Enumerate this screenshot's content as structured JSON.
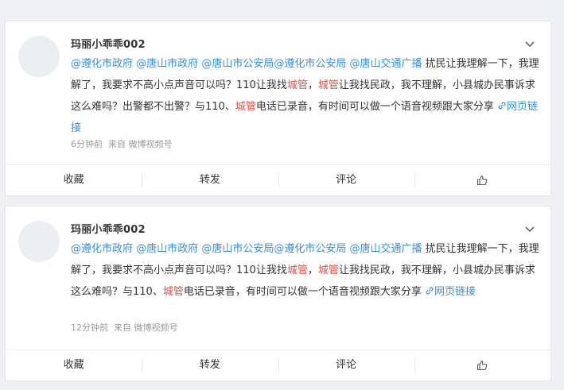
{
  "posts": [
    {
      "author": "玛丽小乖乖002",
      "mentions": [
        "@遵化市政府",
        "@唐山市政府",
        "@唐山市公安局",
        "@遵化市公安局",
        "@唐山交通广播"
      ],
      "segments": [
        {
          "type": "text",
          "text": " 扰民让我理解一下，我理解了，我要求不高小点声音可以吗？110让我找"
        },
        {
          "type": "hl",
          "text": "城管"
        },
        {
          "type": "text",
          "text": "，"
        },
        {
          "type": "hl",
          "text": "城管"
        },
        {
          "type": "text",
          "text": "让我找民政，我不理解，小县城办民事诉求这么难吗？出警都不出警？与110、"
        },
        {
          "type": "hl",
          "text": "城管"
        },
        {
          "type": "text",
          "text": "电话已录音，有时间可以做一个语音视频跟大家分享 "
        }
      ],
      "link_label": "网页链接",
      "time": "6分钟前",
      "source": "来自 微博视频号"
    },
    {
      "author": "玛丽小乖乖002",
      "mentions": [
        "@遵化市政府",
        "@唐山市政府",
        "@唐山市公安局",
        "@遵化市公安局",
        "@唐山交通广播"
      ],
      "segments": [
        {
          "type": "text",
          "text": " 扰民让我理解一下，我理解了，我要求不高小点声音可以吗？110让我找"
        },
        {
          "type": "hl",
          "text": "城管"
        },
        {
          "type": "text",
          "text": "，"
        },
        {
          "type": "hl",
          "text": "城管"
        },
        {
          "type": "text",
          "text": "让我找民政，我不理解，小县城办民事诉求这么难吗？与110、"
        },
        {
          "type": "hl",
          "text": "城管"
        },
        {
          "type": "text",
          "text": "电话已录音，有时间可以做一个语音视频跟大家分享 "
        }
      ],
      "link_label": "网页链接",
      "time": "12分钟前",
      "source": "来自 微博视频号"
    }
  ],
  "actions": {
    "favorite": "收藏",
    "repost": "转发",
    "comment": "评论",
    "like_icon": "thumbs-up-icon"
  },
  "icons": {
    "menu": "chevron-down-icon",
    "link": "link-icon"
  },
  "colors": {
    "mention": "#3a8ed6",
    "highlight": "#e0504a"
  }
}
